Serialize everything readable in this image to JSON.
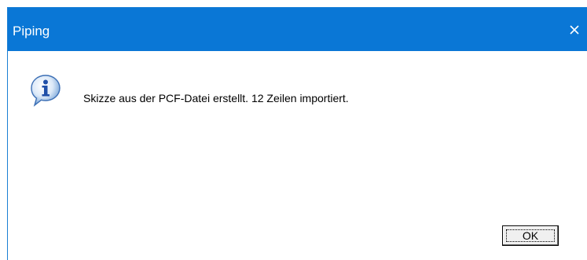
{
  "dialog": {
    "title": "Piping",
    "close_icon": "close-icon",
    "info_icon": "info-icon",
    "message": "Skizze aus der PCF-Datei erstellt. 12 Zeilen importiert.",
    "ok_label": "OK"
  },
  "colors": {
    "titlebar": "#0a77d6",
    "background": "#ffffff",
    "button_face": "#f0f0f0"
  }
}
